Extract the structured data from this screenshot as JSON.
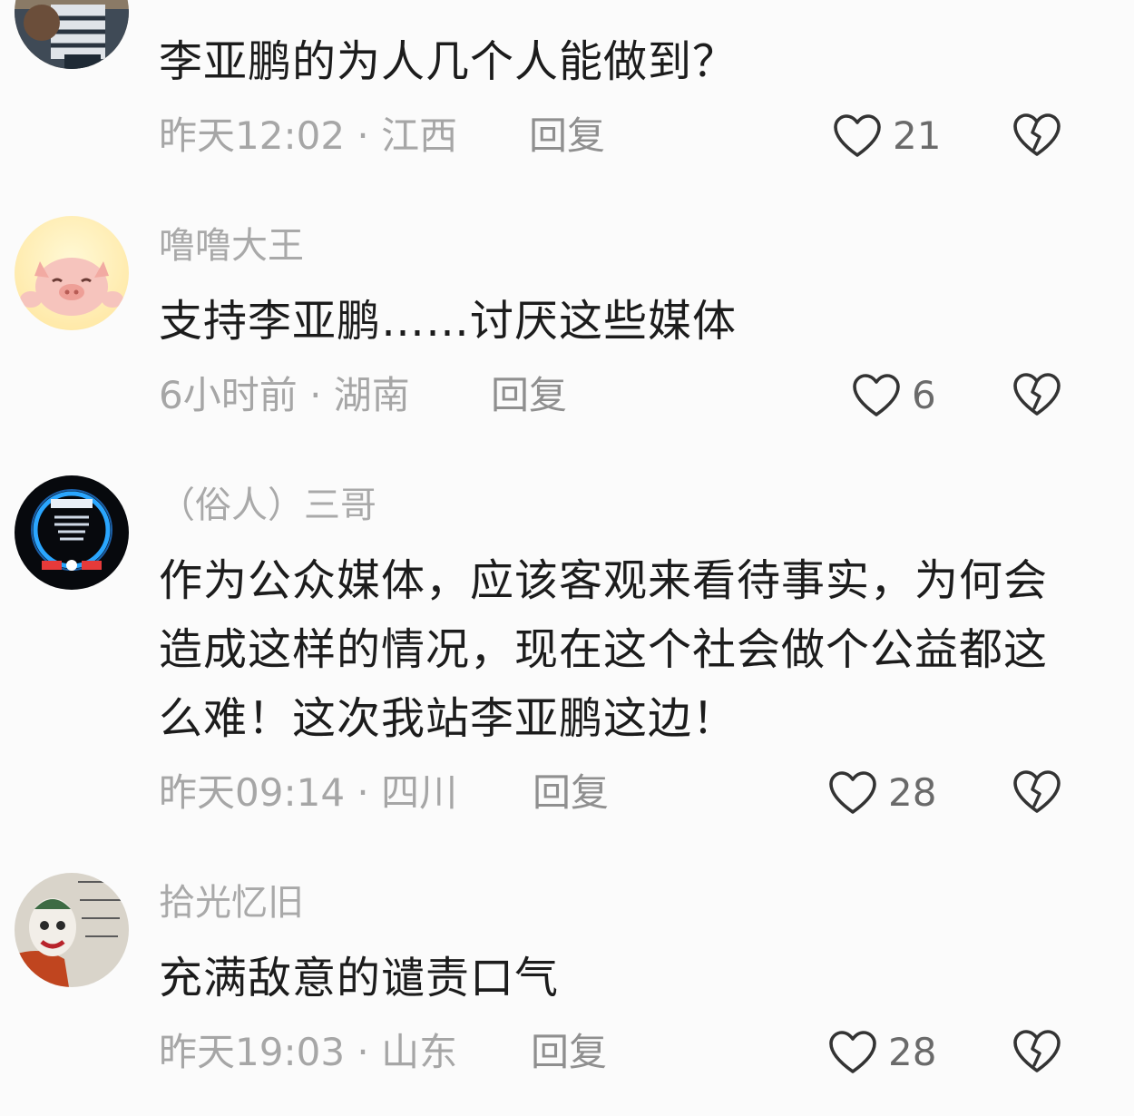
{
  "comments": [
    {
      "username": "",
      "text": "李亚鹏的为人几个人能做到？",
      "time": "昨天12:02",
      "location": "江西",
      "reply_label": "回复",
      "likes": "21",
      "avatar_icon": "dog-photo-avatar"
    },
    {
      "username": "噜噜大王",
      "text": "支持李亚鹏……讨厌这些媒体",
      "time": "6小时前",
      "location": "湖南",
      "reply_label": "回复",
      "likes": "6",
      "avatar_icon": "pig-cartoon-avatar"
    },
    {
      "username": "（俗人）三哥",
      "text": "作为公众媒体，应该客观来看待事实，为何会造成这样的情况，现在这个社会做个公益都这么难！这次我站李亚鹏这边！",
      "time": "昨天09:14",
      "location": "四川",
      "reply_label": "回复",
      "likes": "28",
      "avatar_icon": "neon-circle-avatar"
    },
    {
      "username": "拾光忆旧",
      "text": "充满敌意的谴责口气",
      "time": "昨天19:03",
      "location": "山东",
      "reply_label": "回复",
      "likes": "28",
      "avatar_icon": "joker-avatar"
    }
  ],
  "separator": " · ",
  "icons": {
    "like": "heart-outline-icon",
    "dislike": "broken-heart-icon"
  },
  "colors": {
    "text": "#1c1c1c",
    "meta": "#a6a6a6",
    "icon": "#333333"
  }
}
